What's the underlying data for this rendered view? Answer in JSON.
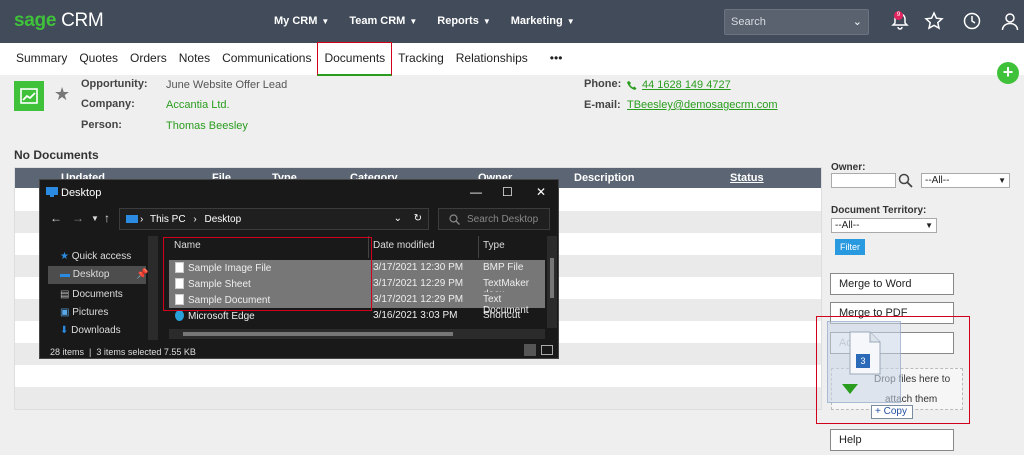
{
  "brand": {
    "sage": "sage",
    "crm": "CRM"
  },
  "topnav": [
    "My CRM",
    "Team CRM",
    "Reports",
    "Marketing"
  ],
  "search": {
    "placeholder": "Search"
  },
  "notifications_count": "9",
  "tabs": [
    "Summary",
    "Quotes",
    "Orders",
    "Notes",
    "Communications",
    "Documents",
    "Tracking",
    "Relationships",
    "•••"
  ],
  "entity": {
    "opportunity_label": "Opportunity:",
    "opportunity": "June Website Offer Lead",
    "company_label": "Company:",
    "company": "Accantia Ltd.",
    "person_label": "Person:",
    "person": "Thomas Beesley",
    "phone_label": "Phone:",
    "phone": "44 1628 149 4727",
    "email_label": "E-mail:",
    "email": "TBeesley@demosagecrm.com"
  },
  "documents": {
    "empty_title": "No Documents",
    "columns": [
      "Updated",
      "File",
      "Type",
      "Category",
      "Owner",
      "Description",
      "Status"
    ]
  },
  "filters": {
    "owner_label": "Owner:",
    "owner_select": "--All--",
    "territory_label": "Document Territory:",
    "territory_select": "--All--",
    "filter_button": "Filter"
  },
  "actions": {
    "merge_word": "Merge to Word",
    "merge_pdf": "Merge to PDF",
    "add_file": "Add File",
    "drop_text_1": "Drop files here to",
    "drop_text_2": "attach them",
    "help": "Help",
    "copy_tag": "+ Copy",
    "drag_count": "3"
  },
  "explorer": {
    "title": "Desktop",
    "path": [
      "This PC",
      "Desktop"
    ],
    "search_placeholder": "Search Desktop",
    "sidebar": [
      "Quick access",
      "Desktop",
      "Documents",
      "Pictures",
      "Downloads"
    ],
    "columns": [
      "Name",
      "Date modified",
      "Type"
    ],
    "files": [
      {
        "name": "Sample Image File",
        "date": "3/17/2021 12:30 PM",
        "type": "BMP File"
      },
      {
        "name": "Sample Sheet",
        "date": "3/17/2021 12:29 PM",
        "type": "TextMaker docu"
      },
      {
        "name": "Sample Document",
        "date": "3/17/2021 12:29 PM",
        "type": "Text Document"
      },
      {
        "name": "Microsoft Edge",
        "date": "3/16/2021 3:03 PM",
        "type": "Shortcut"
      }
    ],
    "status_items": "28 items",
    "status_selected": "3 items selected  7.55 KB"
  }
}
